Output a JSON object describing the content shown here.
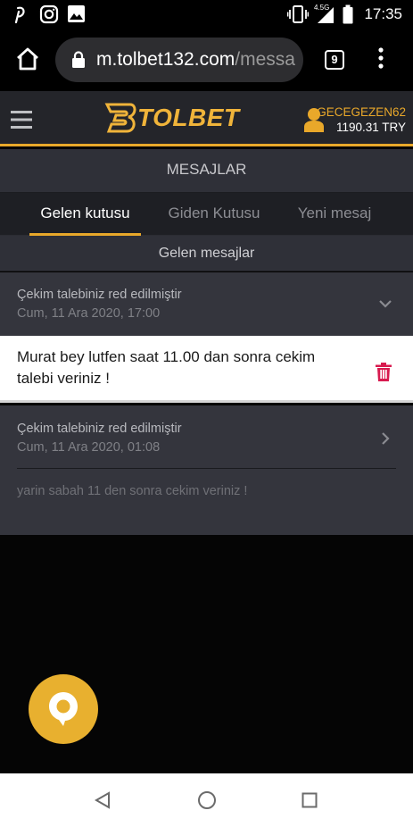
{
  "status_bar": {
    "time": "17:35",
    "network": "4.5G",
    "icons": [
      "pinterest-icon",
      "instagram-icon",
      "image-icon",
      "vibrate-icon",
      "signal-icon",
      "battery-icon"
    ]
  },
  "browser": {
    "url_host": "m.tolbet132.com",
    "url_path": "/messa",
    "tab_count": "9",
    "icons": [
      "home-icon",
      "lock-icon",
      "menu-dots-icon"
    ]
  },
  "header": {
    "logo": "TOLBET",
    "username": "GECEGEZEN62",
    "balance": "1190.31 TRY"
  },
  "page_title": "MESAJLAR",
  "tabs": [
    {
      "label": "Gelen kutusu",
      "active": true
    },
    {
      "label": "Giden Kutusu",
      "active": false
    },
    {
      "label": "Yeni mesaj",
      "active": false
    }
  ],
  "section_title": "Gelen mesajlar",
  "messages": [
    {
      "subject": "Çekim talebiniz red edilmiştir",
      "date": "Cum, 11 Ara 2020, 17:00",
      "body": "Murat bey lutfen saat 11.00 dan sonra cekim talebi veriniz !",
      "expanded": true
    },
    {
      "subject": "Çekim talebiniz red edilmiştir",
      "date": "Cum, 11 Ara 2020, 01:08",
      "preview": "yarin sabah 11 den sonra cekim veriniz !",
      "expanded": false
    }
  ],
  "colors": {
    "accent": "#e9a82a",
    "header_bg": "#24252a",
    "message_bg": "#34353d",
    "delete": "#d81b4f"
  }
}
